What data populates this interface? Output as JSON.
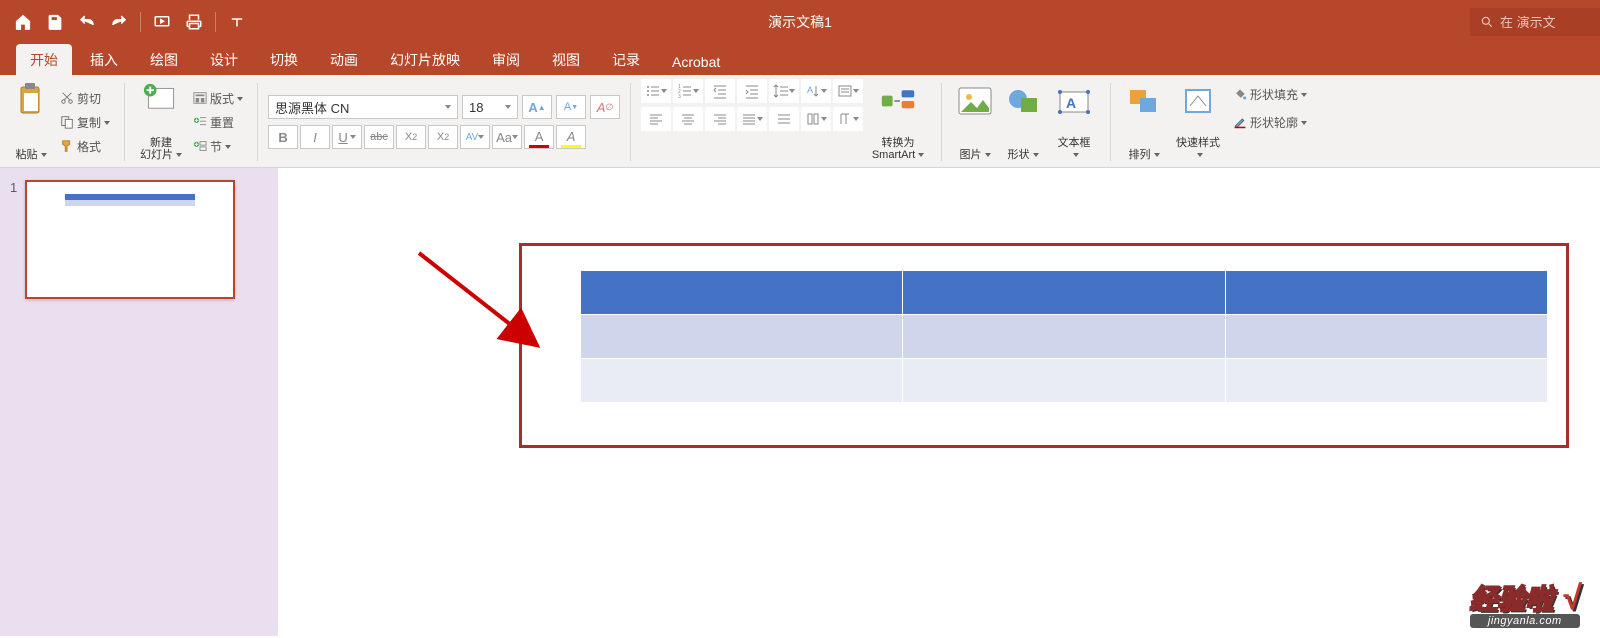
{
  "titlebar": {
    "doc_title": "演示文稿1",
    "search_placeholder": "在 演示文"
  },
  "tabs": [
    {
      "label": "开始",
      "active": true
    },
    {
      "label": "插入"
    },
    {
      "label": "绘图"
    },
    {
      "label": "设计"
    },
    {
      "label": "切换"
    },
    {
      "label": "动画"
    },
    {
      "label": "幻灯片放映"
    },
    {
      "label": "审阅"
    },
    {
      "label": "视图"
    },
    {
      "label": "记录"
    },
    {
      "label": "Acrobat"
    }
  ],
  "ribbon": {
    "paste": "粘贴",
    "cut": "剪切",
    "copy": "复制",
    "format": "格式",
    "new_slide": "新建\n幻灯片",
    "layout": "版式",
    "reset": "重置",
    "section": "节",
    "font_name": "思源黑体 CN",
    "font_size": "18",
    "btn_big_a": "A",
    "btn_small_a": "A",
    "btn_clear": "A∅",
    "btn_bold": "B",
    "btn_italic": "I",
    "btn_under": "U",
    "btn_strike": "abc",
    "btn_sup": "X²",
    "btn_sub": "X₂",
    "btn_spacing": "AV",
    "btn_case": "Aa",
    "convert_smartart": "转换为\nSmartArt",
    "picture": "图片",
    "shapes": "形状",
    "textbox": "文本框",
    "arrange": "排列",
    "quick_style": "快速样式",
    "shape_fill": "形状填充",
    "shape_outline": "形状轮廓"
  },
  "slides": {
    "thumb_number": "1"
  },
  "watermark": {
    "text1": "经验啦",
    "check": "√",
    "text2": "jingyanla.com"
  }
}
